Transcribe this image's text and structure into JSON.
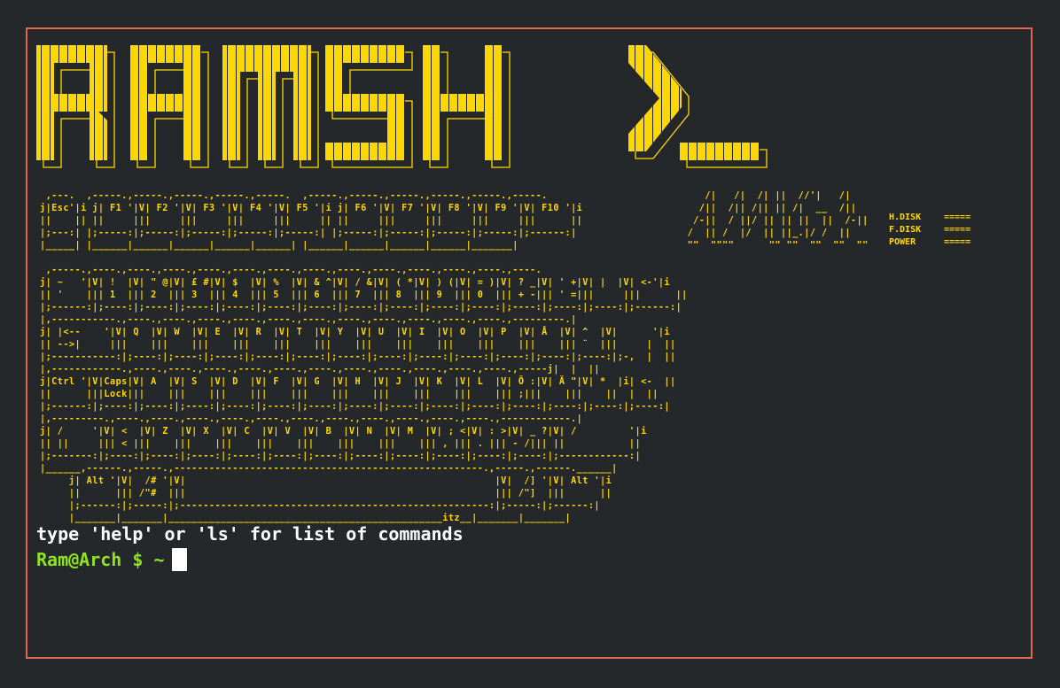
{
  "banner": {
    "text": "RAMSH >_",
    "color": "#ffd700"
  },
  "status": [
    {
      "label": "H.DISK",
      "value": "====="
    },
    {
      "label": "F.DISK",
      "value": "====="
    },
    {
      "label": "POWER",
      "value": "====="
    }
  ],
  "terminal": {
    "help": "type 'help' or 'ls' for list of commands",
    "prompt": "Ram@Arch $ ~",
    "border_color": "#e0674f",
    "background": "#25282b",
    "prompt_color": "#8fe21e"
  },
  "keyboard_ascii": " ,---.  ,-----.,-----.,-----.,-----.,-----.  ,-----.,-----.,-----.,-----.,-----.,-----.\nj|Esc'|i j| F1 '|V| F2 '|V| F3 '|V| F4 '|V| F5 '|i j| F6 '|V| F7 '|V| F8 '|V| F9 '|V| F10 '|i\n||    || ||     |||     |||     |||     |||     || ||     |||     |||     |||     |||      ||\n|;---:| |;-----:|;-----:|;-----:|;-----:|;-----:| |;-----:|;-----:|;-----:|;-----:|;------:|\n|_____| |______|______|______|______|______| |______|______|______|______|_______|\n\n ,-----.,----.,----.,----.,----.,----.,----.,----.,----.,----.,----.,----.,----.,----.\nj| ~   '|V| !  |V| \" @|V| £ #|V| $  |V| %  |V| & ^|V| / &|V| ( *|V| ) (|V| = )|V| ? _|V| ' +|V| |  |V| <-'|i\n|| '    ||| 1  ||| 2  ||| 3  ||| 4  ||| 5  ||| 6  ||| 7  ||| 8  ||| 9  ||| 0  ||| + -||| ' =|||     |||      ||\n|;------:|;----:|;----:|;----:|;----:|;----:|;----:|;----:|;----:|;----:|;----:|;----:|;----:|;----:|;------:|\n|,-----------.,----.,----.,----.,----.,----.,----.,----.,----.,----.,----.,----.,---------.|\nj| |<--    '|V| Q  |V| W  |V| E  |V| R  |V| T  |V| Y  |V| U  |V| I  |V| O  |V| P  |V| Å  |V| ^  |V|      '|i\n|| -->|     |||    |||    |||    |||    |||    |||    |||    |||    |||    |||    |||    ||| ¨  |||     |  ||\n|;-----------:|;----:|;----:|;----:|;----:|;----:|;----:|;----:|;----:|;----:|;----:|;----:|;----:|;-,  |  ||\n|,------------.,----.,----.,----.,----.,----.,----.,----.,----.,----.,----.,----.,-----j|  |  ||\nj|Ctrl '|V|Caps|V| A  |V| S  |V| D  |V| F  |V| G  |V| H  |V| J  |V| K  |V| L  |V| Ö :|V| Ä \"|V| *  |i| <-  ||\n||      |||Lock|||    |||    |||    |||    |||    |||    |||    |||    |||    ||| ;|||    |||    ||  |  ||\n|;------:|;----:|;----:|;----:|;----:|;----:|;----:|;----:|;----:|;----:|;----:|;----:|;----:|;----:|;----:|\n|,---------.,----.,----.,----.,----.,----.,----.,----.,----.,----.,----.,----.,------------.|\nj| /     '|V| <  |V| Z  |V| X  |V| C  |V| V  |V| B  |V| N  |V| M  |V| ; <|V| : >|V| _ ?|V| /         '|i\n|| ||     ||| < |||    |||    |||    |||    |||    |||    |||    ||| , ||| . ||| - /||| ||           ||\n|;-------:|;----:|;----:|;----:|;----:|;----:|;----:|;----:|;----:|;----:|;----:|;----:|;------------:|\n|______,------.,-----.,-----------------------------------------------------.,-----.,------.______|\n     j| Alt '|V|  /# '|V|                                                     |V|  /] '|V| Alt '|i\n     ||      ||| /\"#  |||                                                     ||| /\"]  |||      ||\n     |;------:|;-----:|;-----------------------------------------------------:|;-----:|;------:|\n     |_______|_______|_______________________________________________itz__|_______|_______|"
}
